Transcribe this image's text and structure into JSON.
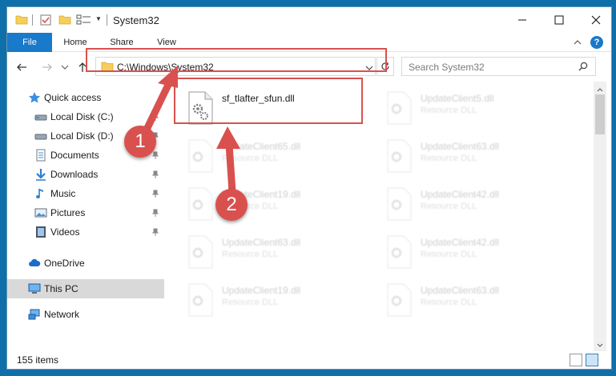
{
  "window": {
    "title": "System32"
  },
  "ribbon": {
    "tabs": [
      {
        "label": "File"
      },
      {
        "label": "Home"
      },
      {
        "label": "Share"
      },
      {
        "label": "View"
      }
    ]
  },
  "address": {
    "path": "C:\\Windows\\System32"
  },
  "search": {
    "placeholder": "Search System32"
  },
  "sidebar": {
    "items": [
      {
        "label": "Quick access",
        "icon": "star-icon"
      },
      {
        "label": "Local Disk (C:)",
        "icon": "drive-icon"
      },
      {
        "label": "Local Disk (D:)",
        "icon": "drive-icon"
      },
      {
        "label": "Documents",
        "icon": "documents-icon"
      },
      {
        "label": "Downloads",
        "icon": "download-icon"
      },
      {
        "label": "Music",
        "icon": "music-icon"
      },
      {
        "label": "Pictures",
        "icon": "pictures-icon"
      },
      {
        "label": "Videos",
        "icon": "videos-icon"
      },
      {
        "label": "OneDrive",
        "icon": "cloud-icon"
      },
      {
        "label": "This PC",
        "icon": "computer-icon",
        "selected": true
      },
      {
        "label": "Network",
        "icon": "network-icon"
      }
    ]
  },
  "files": [
    {
      "name": "sf_tlafter_sfun.dll",
      "type": ""
    },
    {
      "name": "UpdateClient5.dll",
      "type": "Resource DLL"
    },
    {
      "name": "UpdateClient65.dll",
      "type": "Resource DLL"
    },
    {
      "name": "UpdateClient63.dll",
      "type": "Resource DLL"
    },
    {
      "name": "UpdateClient19.dll",
      "type": "Resource DLL"
    },
    {
      "name": "UpdateClient42.dll",
      "type": "Resource DLL"
    },
    {
      "name": "UpdateClient63.dll",
      "type": "Resource DLL"
    },
    {
      "name": "UpdateClient42.dll",
      "type": "Resource DLL"
    },
    {
      "name": "UpdateClient19.dll",
      "type": "Resource DLL"
    },
    {
      "name": "UpdateClient63.dll",
      "type": "Resource DLL"
    }
  ],
  "status": {
    "item_count": "155 items"
  },
  "annotations": {
    "step1": "1",
    "step2": "2"
  },
  "colors": {
    "accent": "#1979ca",
    "annotation": "#d9514e",
    "selection": "#d9d9d9"
  }
}
